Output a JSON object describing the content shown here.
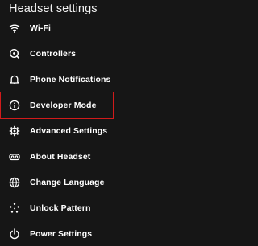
{
  "header": {
    "title": "Headset settings"
  },
  "menu": {
    "items": [
      {
        "label": "Wi-Fi",
        "icon": "wifi-icon"
      },
      {
        "label": "Controllers",
        "icon": "controller-icon"
      },
      {
        "label": "Phone Notifications",
        "icon": "bell-icon"
      },
      {
        "label": "Developer Mode",
        "icon": "info-icon"
      },
      {
        "label": "Advanced Settings",
        "icon": "gear-icon"
      },
      {
        "label": "About Headset",
        "icon": "headset-icon"
      },
      {
        "label": "Change Language",
        "icon": "globe-icon"
      },
      {
        "label": "Unlock Pattern",
        "icon": "pattern-icon"
      },
      {
        "label": "Power Settings",
        "icon": "power-icon"
      }
    ]
  },
  "colors": {
    "background": "#161616",
    "highlight_border": "#d11b1b",
    "text": "#ffffff"
  }
}
